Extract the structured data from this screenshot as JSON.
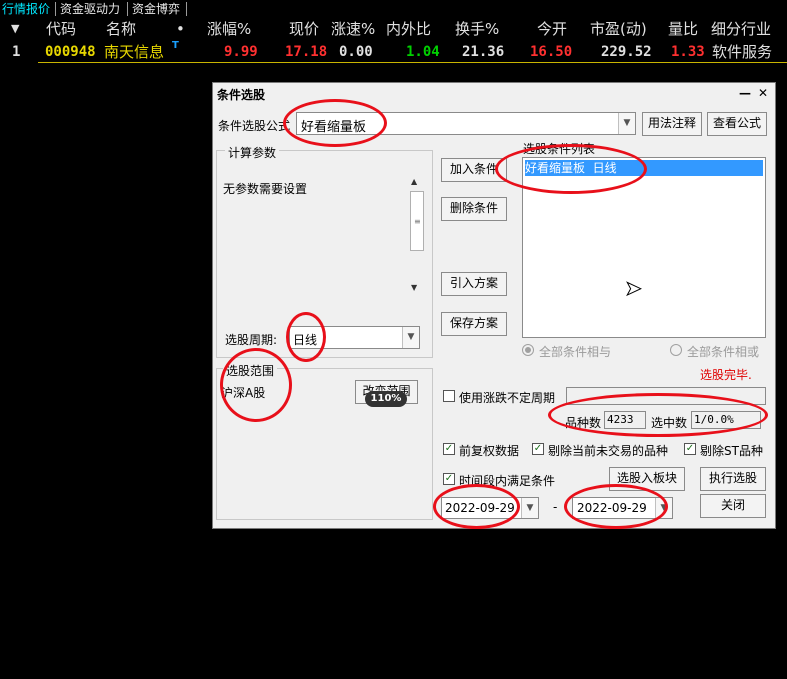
{
  "tabs": [
    "行情报价",
    "资金驱动力",
    "资金博弈"
  ],
  "columns": {
    "arrow": "▼",
    "code": "代码",
    "name": "名称",
    "dot": "•",
    "change_pct": "涨幅%",
    "price": "现价",
    "speed": "涨速%",
    "in_out": "内外比",
    "turnover": "换手%",
    "open": "今开",
    "pe": "市盈(动)",
    "vol_ratio": "量比",
    "industry": "细分行业"
  },
  "rows": [
    {
      "index": "1",
      "code": "000948",
      "name": "南天信息",
      "mark": "T",
      "change_pct": "9.99",
      "price": "17.18",
      "speed": "0.00",
      "in_out": "1.04",
      "turnover": "21.36",
      "open": "16.50",
      "pe": "229.52",
      "vol_ratio": "1.33",
      "industry": "软件服务"
    }
  ],
  "dialog": {
    "title": "条件选股",
    "formula_label": "条件选股公式",
    "formula_value": "好看缩量板",
    "usage_button": "用法注释",
    "view_formula_button": "查看公式",
    "params_group": "计算参数",
    "no_params": "无参数需要设置",
    "period_label": "选股周期:",
    "period_value": "日线",
    "scope_group": "选股范围",
    "scope_value": "沪深A股",
    "change_scope_button": "改变范围",
    "zoom_badge": "110%",
    "add_condition": "加入条件",
    "delete_condition": "删除条件",
    "import_plan": "引入方案",
    "save_plan": "保存方案",
    "condition_list_label": "选股条件列表",
    "conditions": [
      "好看缩量板  日线"
    ],
    "all_and": "全部条件相与",
    "all_or": "全部条件相或",
    "status": "选股完毕.",
    "use_irregular_period": "使用涨跌不定周期",
    "variety_count_label": "品种数",
    "variety_count": "4233",
    "selected_label": "选中数",
    "selected_value": "1/0.0%",
    "pre_adjust": "前复权数据",
    "exclude_untraded": "剔除当前未交易的品种",
    "exclude_st": "剔除ST品种",
    "period_satisfy": "时间段内满足条件",
    "select_to_block": "选股入板块",
    "execute": "执行选股",
    "date_from": "2022-09-29",
    "date_sep": "-",
    "date_to": "2022-09-29",
    "close": "关闭"
  },
  "colors": {
    "up_red": "#ff3030",
    "down_green": "#00d000",
    "code_yellow": "#e8d800",
    "selection_blue": "#3399ff",
    "status_red": "#e00000",
    "annotation_red": "#e8101a"
  }
}
